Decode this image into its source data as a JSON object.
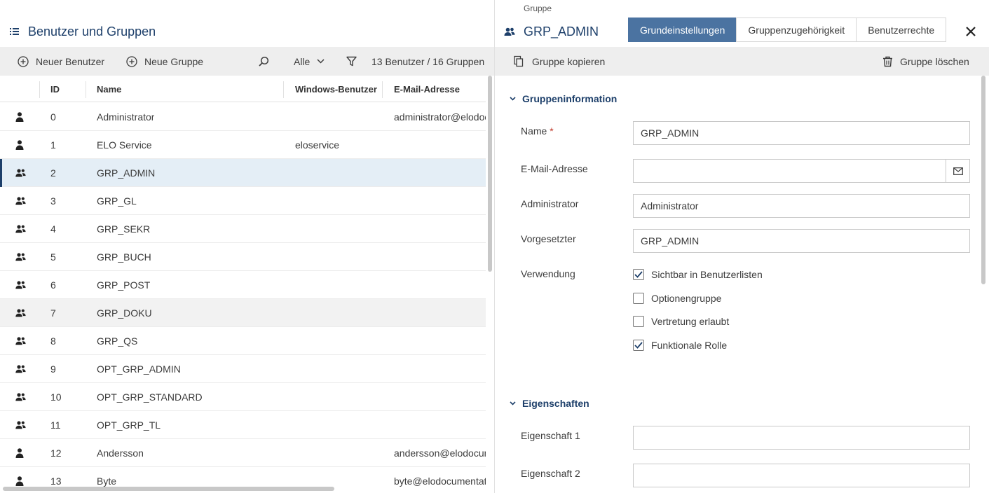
{
  "left": {
    "title": "Benutzer und Gruppen",
    "toolbar": {
      "new_user": "Neuer Benutzer",
      "new_group": "Neue Gruppe",
      "filter_value": "Alle",
      "count": "13 Benutzer / 16 Gruppen"
    },
    "columns": {
      "id": "ID",
      "name": "Name",
      "windows_user": "Windows-Benutzer",
      "email": "E-Mail-Adresse"
    },
    "rows": [
      {
        "type": "user",
        "id": "0",
        "name": "Administrator",
        "windows": "",
        "email": "administrator@elodocumentation.com"
      },
      {
        "type": "user",
        "id": "1",
        "name": "ELO Service",
        "windows": "eloservice",
        "email": ""
      },
      {
        "type": "group",
        "id": "2",
        "name": "GRP_ADMIN",
        "windows": "",
        "email": ""
      },
      {
        "type": "group",
        "id": "3",
        "name": "GRP_GL",
        "windows": "",
        "email": ""
      },
      {
        "type": "group",
        "id": "4",
        "name": "GRP_SEKR",
        "windows": "",
        "email": ""
      },
      {
        "type": "group",
        "id": "5",
        "name": "GRP_BUCH",
        "windows": "",
        "email": ""
      },
      {
        "type": "group",
        "id": "6",
        "name": "GRP_POST",
        "windows": "",
        "email": ""
      },
      {
        "type": "group",
        "id": "7",
        "name": "GRP_DOKU",
        "windows": "",
        "email": ""
      },
      {
        "type": "group",
        "id": "8",
        "name": "GRP_QS",
        "windows": "",
        "email": ""
      },
      {
        "type": "group",
        "id": "9",
        "name": "OPT_GRP_ADMIN",
        "windows": "",
        "email": ""
      },
      {
        "type": "group",
        "id": "10",
        "name": "OPT_GRP_STANDARD",
        "windows": "",
        "email": ""
      },
      {
        "type": "group",
        "id": "11",
        "name": "OPT_GRP_TL",
        "windows": "",
        "email": ""
      },
      {
        "type": "user",
        "id": "12",
        "name": "Andersson",
        "windows": "",
        "email": "andersson@elodocumentation.com"
      },
      {
        "type": "user",
        "id": "13",
        "name": "Byte",
        "windows": "",
        "email": "byte@elodocumentation.com"
      }
    ]
  },
  "right": {
    "kind": "Gruppe",
    "title": "GRP_ADMIN",
    "tabs": [
      "Grundeinstellungen",
      "Gruppenzugehörigkeit",
      "Benutzerrechte"
    ],
    "toolbar": {
      "copy": "Gruppe kopieren",
      "delete": "Gruppe löschen"
    },
    "section_info": "Gruppeninformation",
    "fields": {
      "name_label": "Name",
      "name_req": "*",
      "name_value": "GRP_ADMIN",
      "email_label": "E-Mail-Adresse",
      "email_value": "",
      "admin_label": "Administrator",
      "admin_value": "Administrator",
      "superior_label": "Vorgesetzter",
      "superior_value": "GRP_ADMIN",
      "usage_label": "Verwendung"
    },
    "checkboxes": [
      {
        "label": "Sichtbar in Benutzerlisten",
        "checked": true
      },
      {
        "label": "Optionengruppe",
        "checked": false
      },
      {
        "label": "Vertretung erlaubt",
        "checked": false
      },
      {
        "label": "Funktionale Rolle",
        "checked": true
      }
    ],
    "section_props": "Eigenschaften",
    "props": {
      "prop1_label": "Eigenschaft 1",
      "prop1_value": "",
      "prop2_label": "Eigenschaft 2",
      "prop2_value": ""
    }
  }
}
